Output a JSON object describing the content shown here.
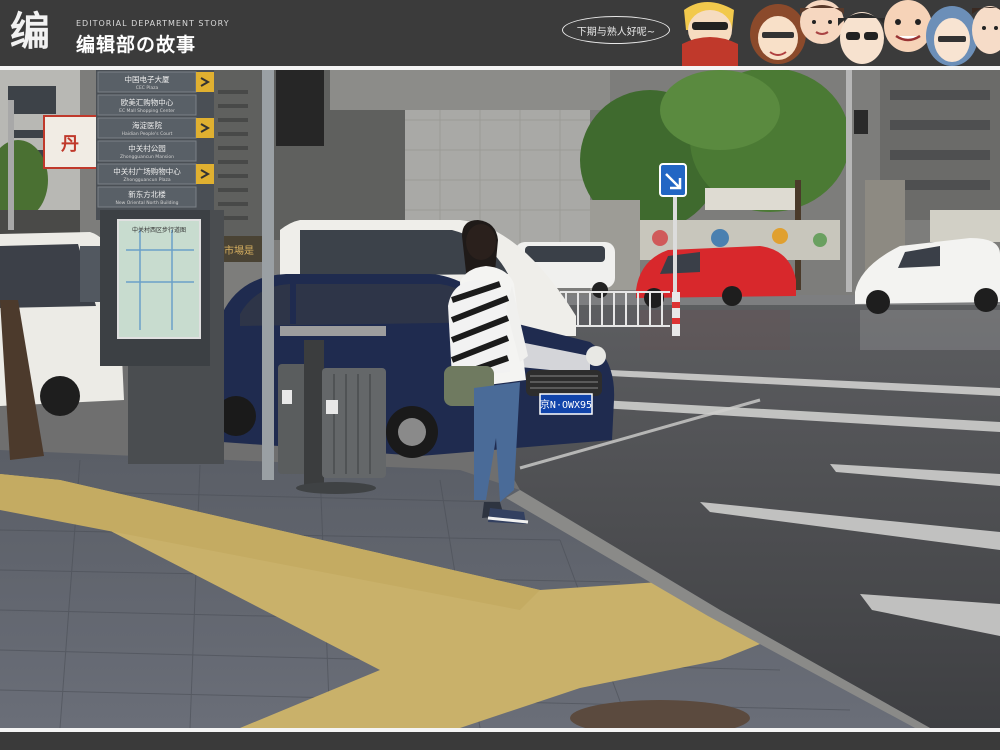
{
  "header": {
    "logo_mark": "编",
    "logo_subtitle": "EDITORIAL DEPARTMENT STORY",
    "logo_title": "编辑部の故事",
    "speech_bubble": "下期与熟人好呢~"
  },
  "photo": {
    "signpost": {
      "items": [
        {
          "zh": "中国电子大厦",
          "en": "CEC Plaza"
        },
        {
          "zh": "欧美汇购物中心",
          "en": "EC Mall Shopping Center"
        },
        {
          "zh": "海淀医院",
          "en": "Haidian People's Court"
        },
        {
          "zh": "中关村公园",
          "en": "Zhongguancun Mansion"
        },
        {
          "zh": "中关村广场购物中心",
          "en": "Zhongguancun Plaza"
        },
        {
          "zh": "新东方北楼",
          "en": "New Oriental North Building"
        }
      ],
      "map_title": "中关村西区步行道图"
    },
    "shop_sign": "丹",
    "storefront_text": "市場是",
    "license_plate": "京N·OWX95"
  },
  "colors": {
    "banner": "#3b3b3b",
    "rule": "#f4f4f4",
    "tactile_paving": "#c9b16a",
    "red_car": "#d8282c",
    "navy_car": "#1f2b4f"
  },
  "icons": [
    "bicycle-lane-sign-icon",
    "trash-bin-icon",
    "manhole-cover-icon"
  ]
}
